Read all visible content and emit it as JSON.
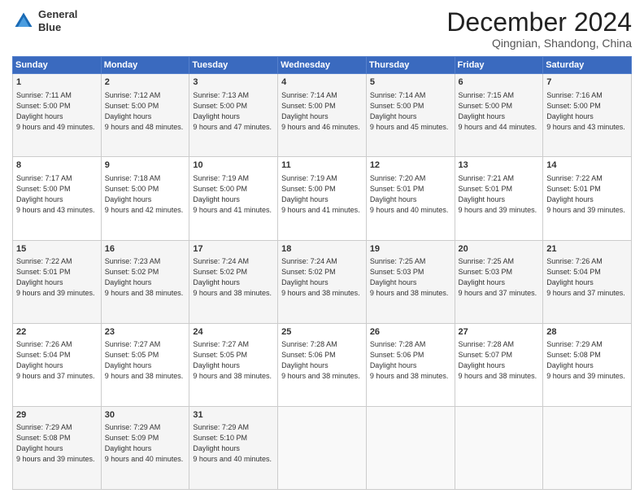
{
  "header": {
    "logo_line1": "General",
    "logo_line2": "Blue",
    "month": "December 2024",
    "location": "Qingnian, Shandong, China"
  },
  "weekdays": [
    "Sunday",
    "Monday",
    "Tuesday",
    "Wednesday",
    "Thursday",
    "Friday",
    "Saturday"
  ],
  "weeks": [
    [
      {
        "day": "1",
        "sunrise": "7:11 AM",
        "sunset": "5:00 PM",
        "daylight": "9 hours and 49 minutes."
      },
      {
        "day": "2",
        "sunrise": "7:12 AM",
        "sunset": "5:00 PM",
        "daylight": "9 hours and 48 minutes."
      },
      {
        "day": "3",
        "sunrise": "7:13 AM",
        "sunset": "5:00 PM",
        "daylight": "9 hours and 47 minutes."
      },
      {
        "day": "4",
        "sunrise": "7:14 AM",
        "sunset": "5:00 PM",
        "daylight": "9 hours and 46 minutes."
      },
      {
        "day": "5",
        "sunrise": "7:14 AM",
        "sunset": "5:00 PM",
        "daylight": "9 hours and 45 minutes."
      },
      {
        "day": "6",
        "sunrise": "7:15 AM",
        "sunset": "5:00 PM",
        "daylight": "9 hours and 44 minutes."
      },
      {
        "day": "7",
        "sunrise": "7:16 AM",
        "sunset": "5:00 PM",
        "daylight": "9 hours and 43 minutes."
      }
    ],
    [
      {
        "day": "8",
        "sunrise": "7:17 AM",
        "sunset": "5:00 PM",
        "daylight": "9 hours and 43 minutes."
      },
      {
        "day": "9",
        "sunrise": "7:18 AM",
        "sunset": "5:00 PM",
        "daylight": "9 hours and 42 minutes."
      },
      {
        "day": "10",
        "sunrise": "7:19 AM",
        "sunset": "5:00 PM",
        "daylight": "9 hours and 41 minutes."
      },
      {
        "day": "11",
        "sunrise": "7:19 AM",
        "sunset": "5:00 PM",
        "daylight": "9 hours and 41 minutes."
      },
      {
        "day": "12",
        "sunrise": "7:20 AM",
        "sunset": "5:01 PM",
        "daylight": "9 hours and 40 minutes."
      },
      {
        "day": "13",
        "sunrise": "7:21 AM",
        "sunset": "5:01 PM",
        "daylight": "9 hours and 39 minutes."
      },
      {
        "day": "14",
        "sunrise": "7:22 AM",
        "sunset": "5:01 PM",
        "daylight": "9 hours and 39 minutes."
      }
    ],
    [
      {
        "day": "15",
        "sunrise": "7:22 AM",
        "sunset": "5:01 PM",
        "daylight": "9 hours and 39 minutes."
      },
      {
        "day": "16",
        "sunrise": "7:23 AM",
        "sunset": "5:02 PM",
        "daylight": "9 hours and 38 minutes."
      },
      {
        "day": "17",
        "sunrise": "7:24 AM",
        "sunset": "5:02 PM",
        "daylight": "9 hours and 38 minutes."
      },
      {
        "day": "18",
        "sunrise": "7:24 AM",
        "sunset": "5:02 PM",
        "daylight": "9 hours and 38 minutes."
      },
      {
        "day": "19",
        "sunrise": "7:25 AM",
        "sunset": "5:03 PM",
        "daylight": "9 hours and 38 minutes."
      },
      {
        "day": "20",
        "sunrise": "7:25 AM",
        "sunset": "5:03 PM",
        "daylight": "9 hours and 37 minutes."
      },
      {
        "day": "21",
        "sunrise": "7:26 AM",
        "sunset": "5:04 PM",
        "daylight": "9 hours and 37 minutes."
      }
    ],
    [
      {
        "day": "22",
        "sunrise": "7:26 AM",
        "sunset": "5:04 PM",
        "daylight": "9 hours and 37 minutes."
      },
      {
        "day": "23",
        "sunrise": "7:27 AM",
        "sunset": "5:05 PM",
        "daylight": "9 hours and 38 minutes."
      },
      {
        "day": "24",
        "sunrise": "7:27 AM",
        "sunset": "5:05 PM",
        "daylight": "9 hours and 38 minutes."
      },
      {
        "day": "25",
        "sunrise": "7:28 AM",
        "sunset": "5:06 PM",
        "daylight": "9 hours and 38 minutes."
      },
      {
        "day": "26",
        "sunrise": "7:28 AM",
        "sunset": "5:06 PM",
        "daylight": "9 hours and 38 minutes."
      },
      {
        "day": "27",
        "sunrise": "7:28 AM",
        "sunset": "5:07 PM",
        "daylight": "9 hours and 38 minutes."
      },
      {
        "day": "28",
        "sunrise": "7:29 AM",
        "sunset": "5:08 PM",
        "daylight": "9 hours and 39 minutes."
      }
    ],
    [
      {
        "day": "29",
        "sunrise": "7:29 AM",
        "sunset": "5:08 PM",
        "daylight": "9 hours and 39 minutes."
      },
      {
        "day": "30",
        "sunrise": "7:29 AM",
        "sunset": "5:09 PM",
        "daylight": "9 hours and 40 minutes."
      },
      {
        "day": "31",
        "sunrise": "7:29 AM",
        "sunset": "5:10 PM",
        "daylight": "9 hours and 40 minutes."
      },
      null,
      null,
      null,
      null
    ]
  ]
}
